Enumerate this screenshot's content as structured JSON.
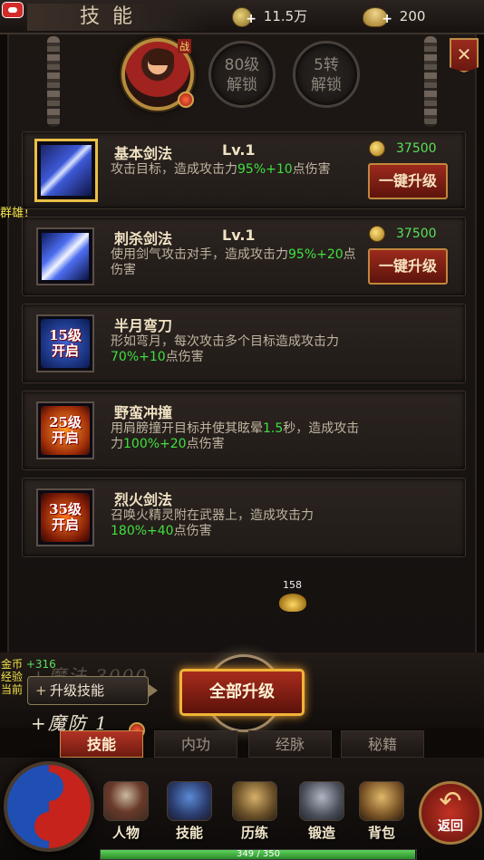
{
  "header": {
    "title": "技能",
    "gold": "11.5万",
    "ingot": "200"
  },
  "hero": {
    "badge": "战",
    "unlock_level_line1": "80级",
    "unlock_level_line2": "解锁",
    "unlock_zhuan_line1": "5转",
    "unlock_zhuan_line2": "解锁"
  },
  "skills": [
    {
      "name": "基本剑法",
      "level": "Lv.1",
      "desc_a": "攻击目标，造成攻击力",
      "desc_h1": "95%+10",
      "desc_b": "点伤害",
      "cost": "37500",
      "button": "一键升级"
    },
    {
      "name": "刺杀剑法",
      "level": "Lv.1",
      "desc_a": "使用剑气攻击对手，造成攻击力",
      "desc_h1": "95%+20",
      "desc_b": "点伤害",
      "cost": "37500",
      "button": "一键升级"
    },
    {
      "name": "半月弯刀",
      "lock_line1": "15级",
      "lock_line2": "开启",
      "desc_a": "形如弯月，每次攻击多个目标造成攻击力",
      "desc_h1": "70%+10",
      "desc_b": "点伤害"
    },
    {
      "name": "野蛮冲撞",
      "lock_line1": "25级",
      "lock_line2": "开启",
      "desc_a": "用肩膀撞开目标并使其眩晕",
      "desc_h1": "1.5",
      "desc_m": "秒，造成攻击力",
      "desc_h2": "100%+20",
      "desc_b": "点伤害"
    },
    {
      "name": "烈火剑法",
      "lock_line1": "35级",
      "lock_line2": "开启",
      "desc_a": "召唤火精灵附在武器上，造成攻击力",
      "desc_h1": "180%+40",
      "desc_b": "点伤害"
    }
  ],
  "side_text": "群雄！",
  "drop": {
    "count": "158"
  },
  "bottom": {
    "faded_text": "+魔法 3000",
    "stat_gold_label": "金币",
    "stat_gold_value": "+316",
    "stat_exp_label": "经验",
    "stat_cur_label": "当前",
    "tip": "升级技能",
    "faded_text2": "+魔防 1",
    "upgrade_all": "全部升级"
  },
  "tabs": [
    {
      "label": "技能",
      "active": true
    },
    {
      "label": "内功",
      "active": false
    },
    {
      "label": "经脉",
      "active": false
    },
    {
      "label": "秘籍",
      "active": false
    }
  ],
  "nav": {
    "items": [
      "人物",
      "技能",
      "历练",
      "锻造",
      "背包"
    ],
    "return_label": "返回",
    "icons": [
      "person-icon",
      "skill-book-icon",
      "train-icon",
      "forge-icon",
      "bag-icon"
    ]
  },
  "exp": {
    "text": "349 / 350",
    "fraction": 0.997
  },
  "colors": {
    "accent_red": "#a72c1c",
    "highlight_green": "#3fe03f",
    "gold_border": "#f0b437"
  }
}
